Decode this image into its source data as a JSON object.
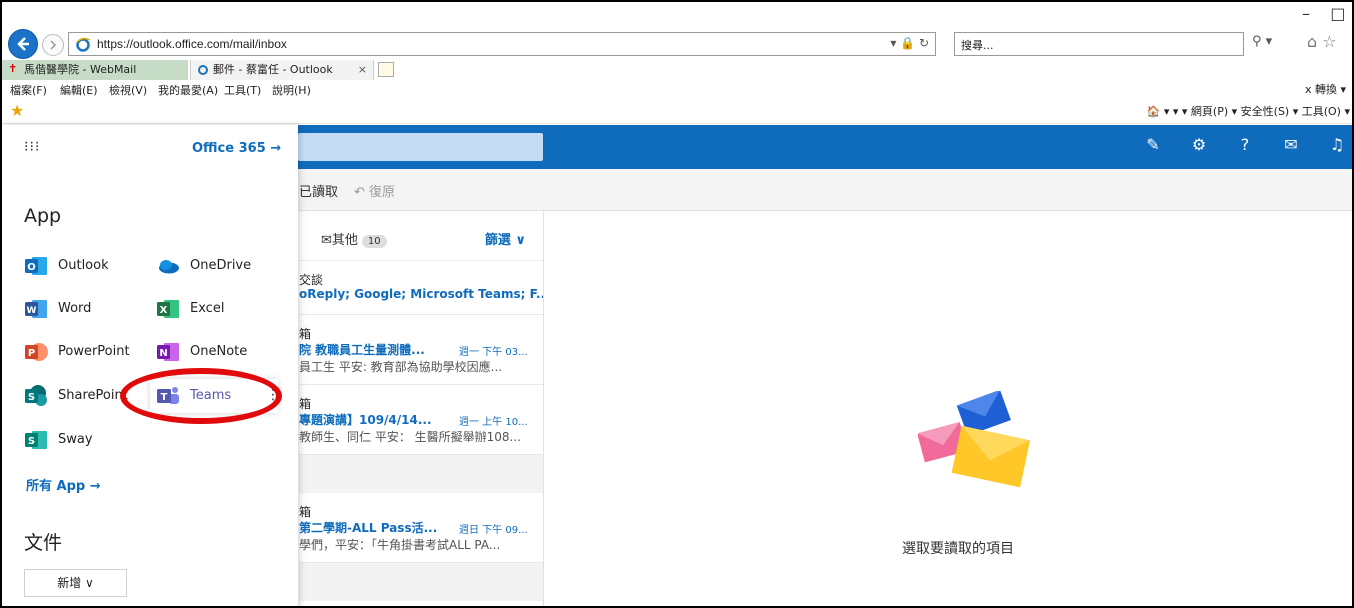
{
  "browser": {
    "url": "https://outlook.office.com/mail/inbox",
    "url_controls": "▾ 🔒 ↻",
    "search_placeholder": "搜尋...",
    "tabs": [
      {
        "label": "馬偕醫學院 - WebMail"
      },
      {
        "label": "郵件 - 蔡富任 - Outlook",
        "close": "×"
      }
    ],
    "menu": [
      "檔案(F)",
      "編輯(E)",
      "檢視(V)",
      "我的最愛(A)",
      "工具(T)",
      "說明(H)"
    ],
    "menu_right": "x  轉換 ▾",
    "command_bar": "🏠 ▾  ▾  ▾  網頁(P) ▾  安全性(S) ▾  工具(O) ▾"
  },
  "launcher": {
    "office_link": "Office 365 →",
    "apps_heading": "App",
    "apps": [
      {
        "name": "Outlook",
        "icon": "outlook-icon",
        "color": "#0f6cbd"
      },
      {
        "name": "OneDrive",
        "icon": "onedrive-icon",
        "color": "#0f6cbd"
      },
      {
        "name": "Word",
        "icon": "word-icon",
        "color": "#2b579a"
      },
      {
        "name": "Excel",
        "icon": "excel-icon",
        "color": "#217346"
      },
      {
        "name": "PowerPoint",
        "icon": "powerpoint-icon",
        "color": "#d24726"
      },
      {
        "name": "OneNote",
        "icon": "onenote-icon",
        "color": "#7719aa"
      },
      {
        "name": "SharePoint",
        "icon": "sharepoint-icon",
        "color": "#03787c"
      },
      {
        "name": "Teams",
        "icon": "teams-icon",
        "color": "#5558af"
      },
      {
        "name": "Sway",
        "icon": "sway-icon",
        "color": "#008272"
      }
    ],
    "all_apps": "所有 App →",
    "docs_heading": "文件",
    "new_button": "新增 ∨"
  },
  "toolbar": {
    "mark_read": "已讀取",
    "undo": "復原"
  },
  "message_list": {
    "other_tab": "其他",
    "other_count": "10",
    "filter": "篩選 ∨",
    "messages": [
      {
        "from": "交談",
        "subject": "oReply; Google; Microsoft Teams; F...",
        "time": "",
        "preview": ""
      },
      {
        "from": "箱",
        "subject": "院 教職員工生量測體...",
        "time": "週一 下午 03...",
        "preview": "員工生 平安: 教育部為協助學校因應..."
      },
      {
        "from": "箱",
        "subject": "專題演講】109/4/14...",
        "time": "週一 上午 10...",
        "preview": "教師生、同仁 平安： 生醫所擬舉辦108..."
      },
      {
        "from": "箱",
        "subject": "第二學期-ALL Pass活...",
        "time": "週日 下午 09...",
        "preview": "學們，平安：「牛角掛書考試ALL PA..."
      }
    ]
  },
  "reading_pane": {
    "empty_text": "選取要讀取的項目"
  },
  "colors": {
    "owa_blue": "#0f6cbd",
    "highlight_ring": "#e10a0a"
  }
}
